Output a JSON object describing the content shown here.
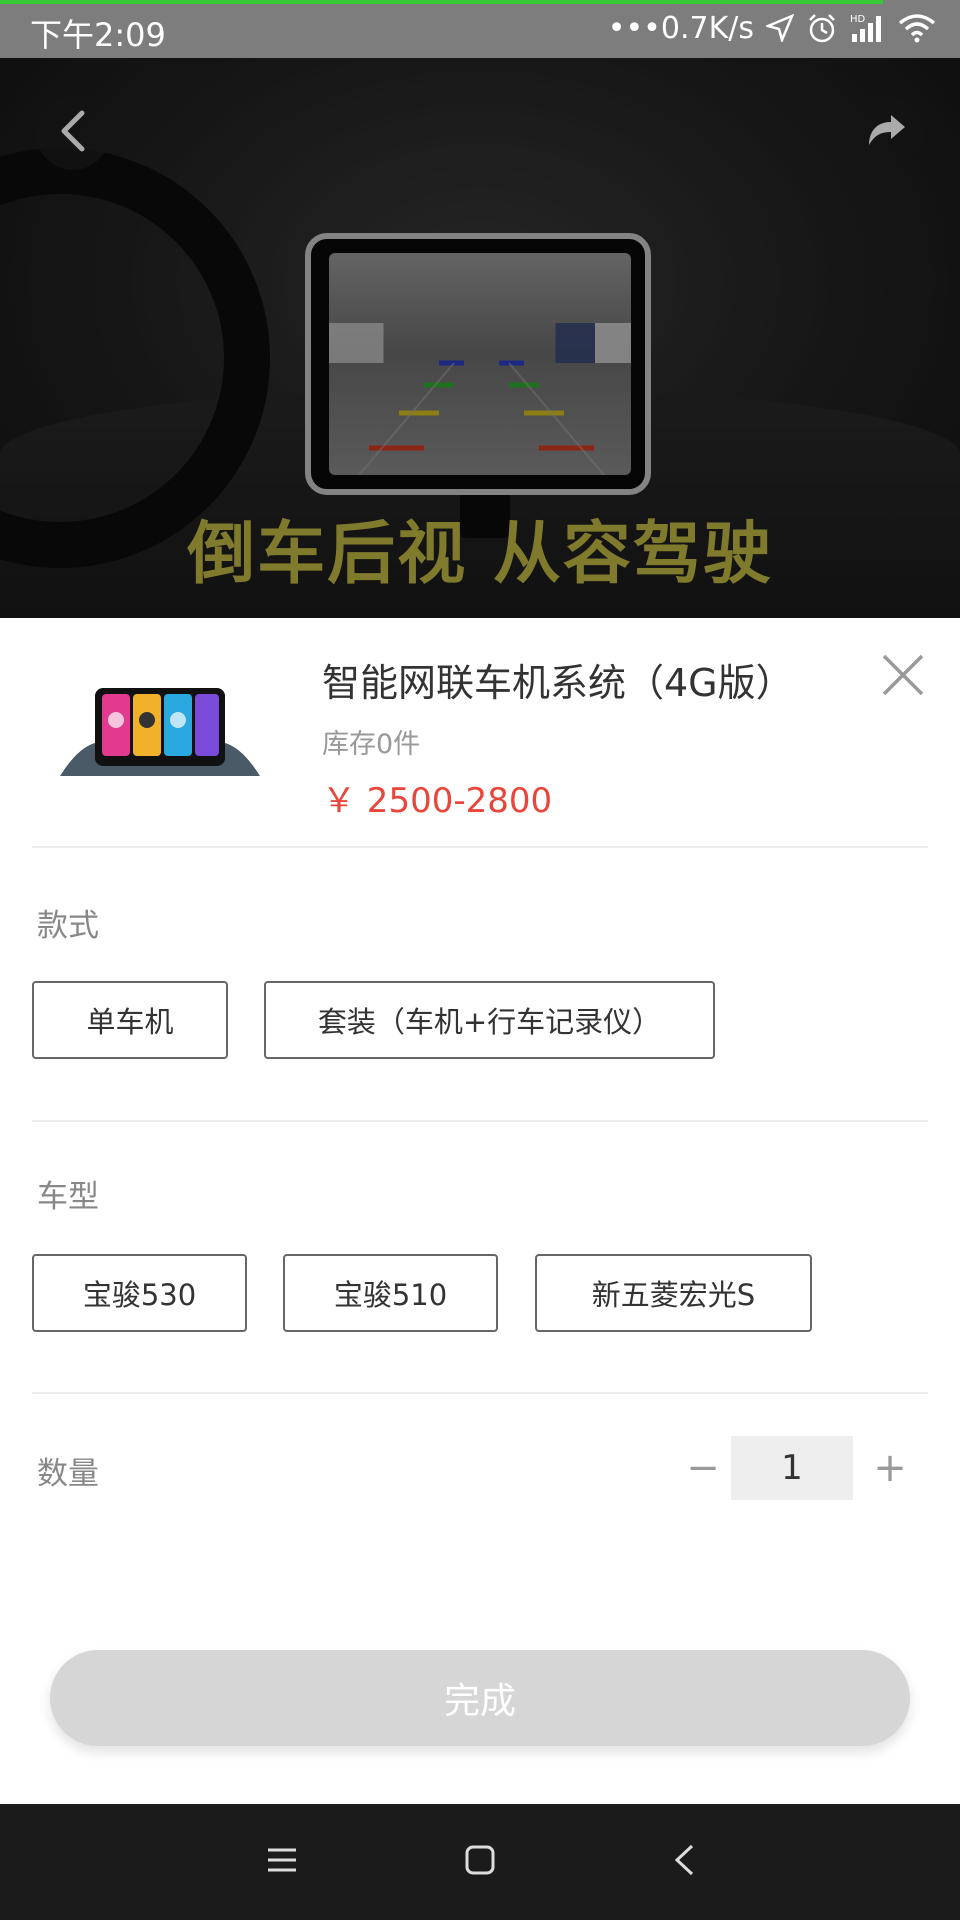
{
  "status_bar": {
    "time": "下午2:09",
    "network_speed": "•••0.7K/s",
    "page_load_progress": 0.92
  },
  "banner": {
    "caption": "倒车后视  从容驾驶",
    "back_icon": "chevron-left-icon",
    "share_icon": "share-arrow-icon"
  },
  "product": {
    "title": "智能网联车机系统（4G版）",
    "stock": "库存0件",
    "price": "￥ 2500-2800"
  },
  "style_section": {
    "label": "款式",
    "options": [
      "单车机",
      "套装（车机+行车记录仪）"
    ]
  },
  "model_section": {
    "label": "车型",
    "options": [
      "宝骏530",
      "宝骏510",
      "新五菱宏光S"
    ]
  },
  "quantity": {
    "label": "数量",
    "minus": "−",
    "value": "1",
    "plus": "+"
  },
  "done_button": "完成",
  "colors": {
    "price": "#e8463a",
    "progress": "#37c936",
    "done_bg": "#d6d6d6"
  }
}
